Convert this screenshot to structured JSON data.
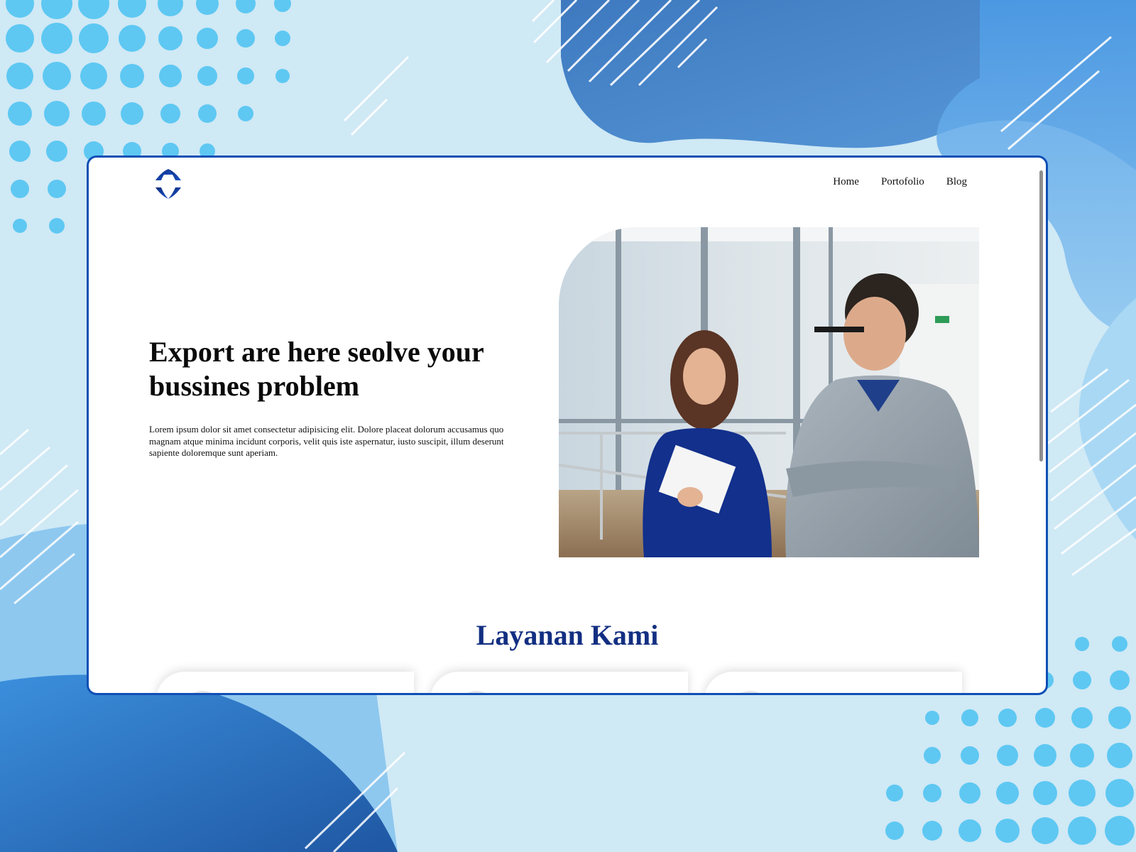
{
  "site": {
    "nav": {
      "home_label": "Home",
      "portfolio_label": "Portofolio",
      "blog_label": "Blog"
    },
    "hero": {
      "title": "Export are here seolve your bussines problem",
      "text": "Lorem ipsum dolor sit amet consectetur adipisicing elit. Dolore placeat dolorum accusamus quo magnam atque minima incidunt corporis, velit quis iste aspernatur, iusto suscipit, illum deserunt sapiente doloremque sunt aperiam."
    },
    "services": {
      "title": "Layanan Kami",
      "card_count": 3
    }
  },
  "colors": {
    "background": "#cfe9f5",
    "frame_border": "#0f4fb5",
    "brand_navy": "#132f82",
    "dot_blue": "#5ec8f2",
    "wave_blue": "#4a86cc"
  },
  "icons": {
    "logo": "four-arc-star-logo-icon"
  }
}
